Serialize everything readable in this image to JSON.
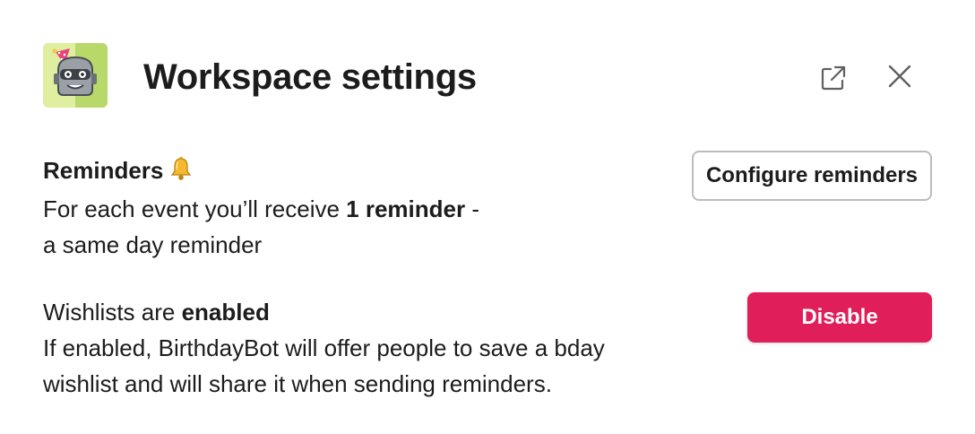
{
  "header": {
    "title": "Workspace settings",
    "app_icon": "birthday-bot-robot-icon",
    "popout_icon": "external-link-icon",
    "close_icon": "close-icon"
  },
  "reminders": {
    "heading": "Reminders",
    "heading_icon": "bell-icon",
    "line1_prefix": "For each event you’ll receive ",
    "line1_bold": "1 reminder",
    "line1_suffix": " -",
    "line2": "a same day reminder",
    "button_label": "Configure reminders"
  },
  "wishlists": {
    "heading_prefix": "Wishlists are ",
    "heading_bold": "enabled",
    "line1": "If enabled, BirthdayBot will offer people to save a bday",
    "line2": "wishlist and will share it when sending reminders.",
    "button_label": "Disable"
  },
  "colors": {
    "danger": "#e01e5a",
    "text": "#1d1c1d",
    "icon_bg": "#c9e27a"
  }
}
